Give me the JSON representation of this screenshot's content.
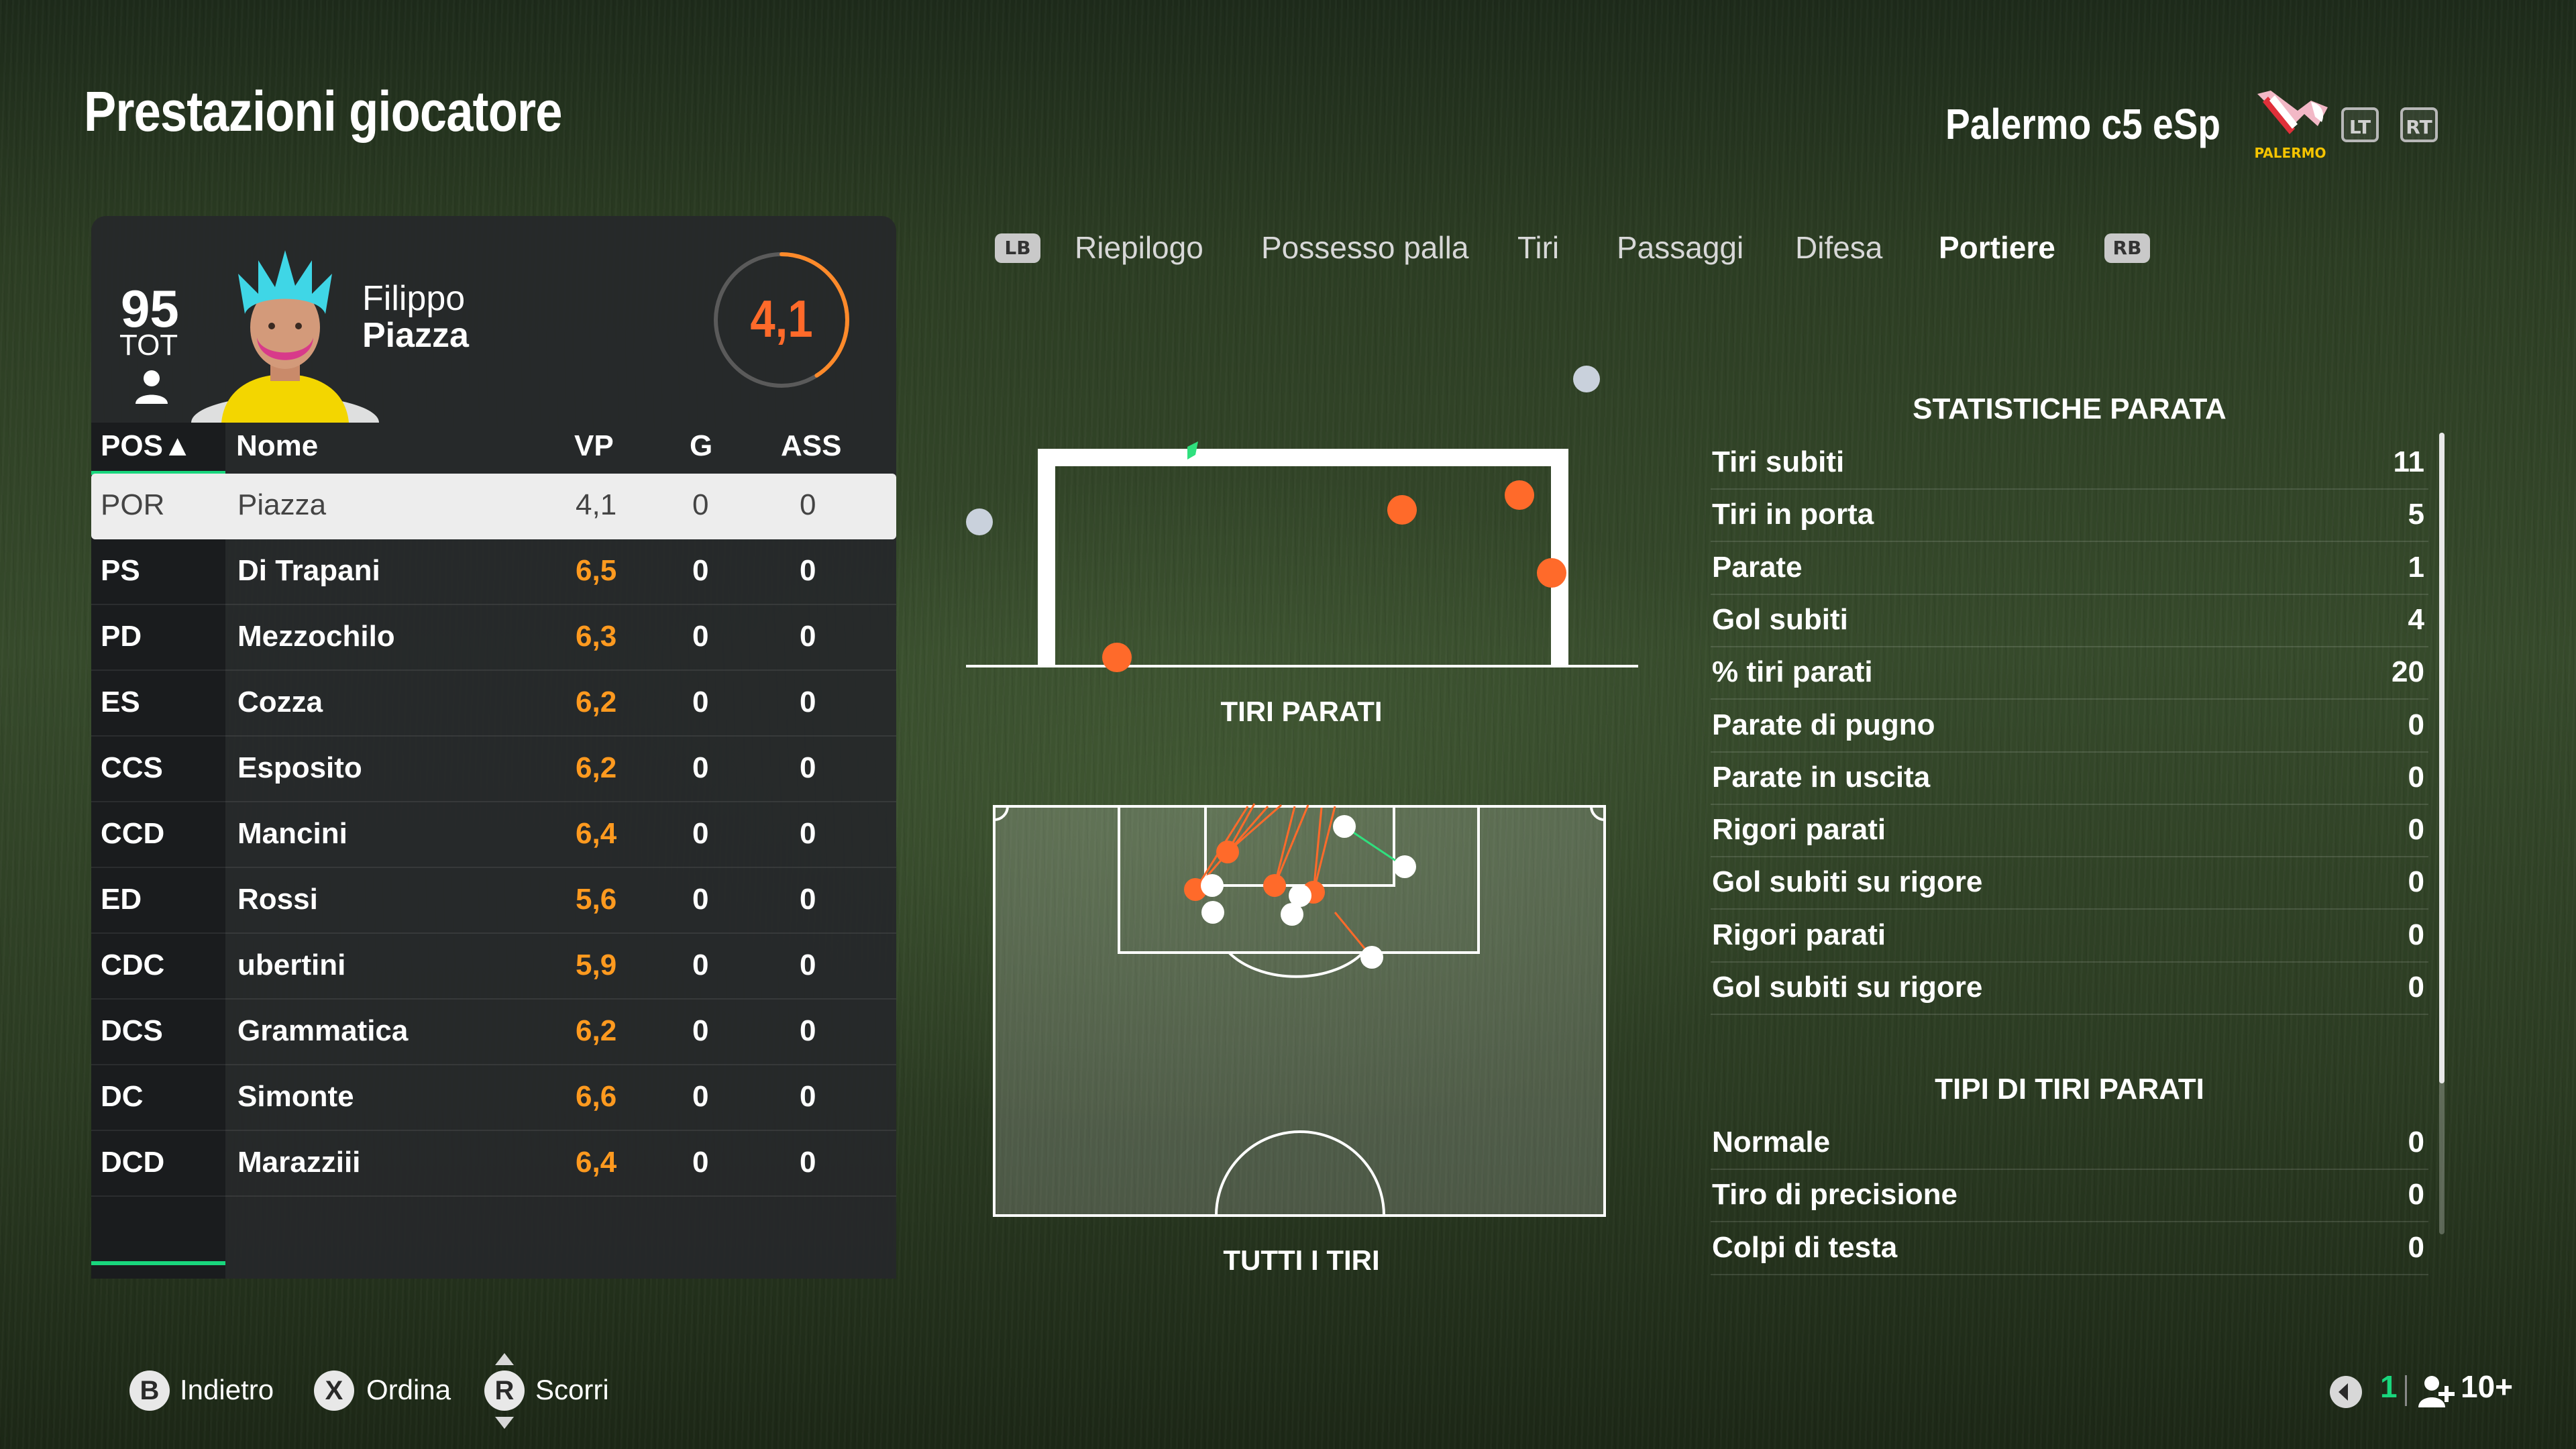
{
  "header": {
    "title": "Prestazioni giocatore",
    "club_name": "Palermo c5 eSp",
    "club_logo_text": "PALERMO",
    "lt_label": "LT",
    "rt_label": "RT"
  },
  "player": {
    "overall": "95",
    "overall_label": "TOT",
    "first_name": "Filippo",
    "last_name": "Piazza",
    "rating": "4,1",
    "rating_fraction": 0.41
  },
  "table": {
    "columns": [
      "POS▲",
      "Nome",
      "VP",
      "G",
      "ASS"
    ],
    "rows": [
      {
        "pos": "POR",
        "name": "Piazza",
        "vp": "4,1",
        "g": "0",
        "ass": "0"
      },
      {
        "pos": "PS",
        "name": "Di Trapani",
        "vp": "6,5",
        "g": "0",
        "ass": "0"
      },
      {
        "pos": "PD",
        "name": "Mezzochilo",
        "vp": "6,3",
        "g": "0",
        "ass": "0"
      },
      {
        "pos": "ES",
        "name": "Cozza",
        "vp": "6,2",
        "g": "0",
        "ass": "0"
      },
      {
        "pos": "CCS",
        "name": "Esposito",
        "vp": "6,2",
        "g": "0",
        "ass": "0"
      },
      {
        "pos": "CCD",
        "name": "Mancini",
        "vp": "6,4",
        "g": "0",
        "ass": "0"
      },
      {
        "pos": "ED",
        "name": "Rossi",
        "vp": "5,6",
        "g": "0",
        "ass": "0"
      },
      {
        "pos": "CDC",
        "name": "ubertini",
        "vp": "5,9",
        "g": "0",
        "ass": "0"
      },
      {
        "pos": "DCS",
        "name": "Grammatica",
        "vp": "6,2",
        "g": "0",
        "ass": "0"
      },
      {
        "pos": "DC",
        "name": "Simonte",
        "vp": "6,6",
        "g": "0",
        "ass": "0"
      },
      {
        "pos": "DCD",
        "name": "Marazziii",
        "vp": "6,4",
        "g": "0",
        "ass": "0"
      }
    ]
  },
  "tabs": {
    "lb": "LB",
    "rb": "RB",
    "items": [
      "Riepilogo",
      "Possesso palla",
      "Tiri",
      "Passaggi",
      "Difesa",
      "Portiere"
    ],
    "active": "Portiere"
  },
  "diagrams": {
    "saved_shots_label": "TIRI PARATI",
    "all_shots_label": "TUTTI I TIRI"
  },
  "stats": {
    "section1_title": "STATISTICHE PARATA",
    "section1": [
      {
        "label": "Tiri subiti",
        "value": "11"
      },
      {
        "label": "Tiri in porta",
        "value": "5"
      },
      {
        "label": "Parate",
        "value": "1"
      },
      {
        "label": "Gol subiti",
        "value": "4"
      },
      {
        "label": "% tiri parati",
        "value": "20"
      },
      {
        "label": "Parate di pugno",
        "value": "0"
      },
      {
        "label": "Parate in uscita",
        "value": "0"
      },
      {
        "label": "Rigori parati",
        "value": "0"
      },
      {
        "label": "Gol subiti su rigore",
        "value": "0"
      },
      {
        "label": "Rigori parati",
        "value": "0"
      },
      {
        "label": "Gol subiti su rigore",
        "value": "0"
      }
    ],
    "section2_title": "TIPI DI TIRI PARATI",
    "section2": [
      {
        "label": "Normale",
        "value": "0"
      },
      {
        "label": "Tiro di precisione",
        "value": "0"
      },
      {
        "label": "Colpi di testa",
        "value": "0"
      }
    ]
  },
  "footer": {
    "back_key": "B",
    "back_label": "Indietro",
    "sort_key": "X",
    "sort_label": "Ordina",
    "scroll_key": "R",
    "scroll_label": "Scorri",
    "count": "1",
    "players": "10+"
  },
  "colors": {
    "accent": "#19d67d",
    "rating": "#ff6a2a",
    "vp": "#ff9a1f"
  }
}
